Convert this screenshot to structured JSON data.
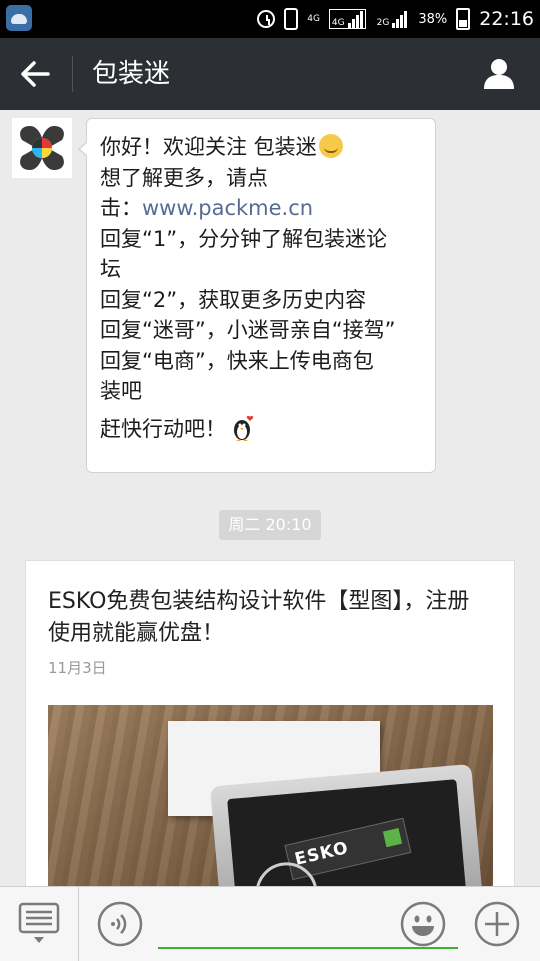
{
  "status_bar": {
    "network_4g_small": "4G",
    "network_4g": "4G",
    "network_2g": "2G",
    "battery": "38%",
    "time": "22:16"
  },
  "header": {
    "title": "包装迷"
  },
  "message": {
    "lines": [
      "你好！欢迎关注 包装迷",
      "想了解更多，请点",
      "击：",
      "回复“1”，分分钟了解包装迷论",
      "坛",
      "回复“2”，获取更多历史内容",
      "回复“迷哥”，小迷哥亲自“接驾”",
      "回复“电商”，快来上传电商包",
      "装吧",
      "赶快行动吧！"
    ],
    "link": "www.packme.cn"
  },
  "timestamp": "周二 20:10",
  "article": {
    "title": "ESKO免费包装结构设计软件【型图】，注册使用就能赢优盘！",
    "date": "11月3日",
    "image_text": "ESKO"
  },
  "icons": {
    "back": "arrow-left",
    "profile": "person",
    "menu": "list",
    "voice": "sound-wave",
    "emoji": "smiley",
    "plus": "plus"
  },
  "colors": {
    "header_bg": "#2c2f34",
    "link": "#576b95",
    "input_underline": "#3cb034",
    "chat_bg": "#ebebeb"
  }
}
